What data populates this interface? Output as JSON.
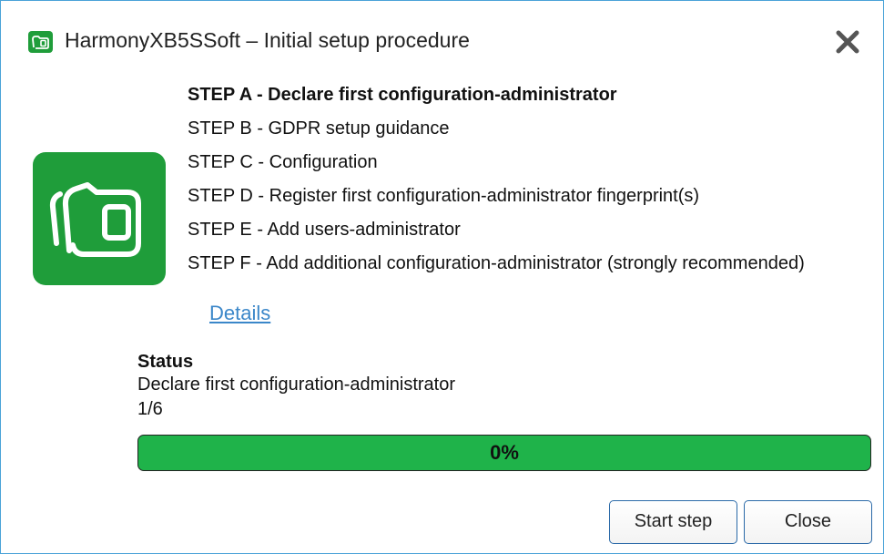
{
  "window": {
    "title": "HarmonyXB5SSoft – Initial setup procedure",
    "app_icon": "harmony-card-icon",
    "close_icon": "close-icon"
  },
  "steps": [
    {
      "label": "STEP A - Declare first configuration-administrator",
      "active": true
    },
    {
      "label": "STEP B - GDPR setup guidance",
      "active": false
    },
    {
      "label": "STEP C - Configuration",
      "active": false
    },
    {
      "label": "STEP D - Register first configuration-administrator fingerprint(s)",
      "active": false
    },
    {
      "label": "STEP E - Add users-administrator",
      "active": false
    },
    {
      "label": "STEP F - Add additional configuration-administrator (strongly recommended)",
      "active": false
    }
  ],
  "details_link": "Details",
  "status": {
    "heading": "Status",
    "text": "Declare first configuration-administrator",
    "count": "1/6"
  },
  "progress": {
    "value_percent": 0,
    "label": "0%"
  },
  "buttons": {
    "start_step": "Start step",
    "close": "Close"
  },
  "colors": {
    "accent_green": "#1f9d3a",
    "progress_green": "#1fb34a",
    "link_blue": "#3b87c9",
    "border_blue": "#4aa3d8"
  }
}
